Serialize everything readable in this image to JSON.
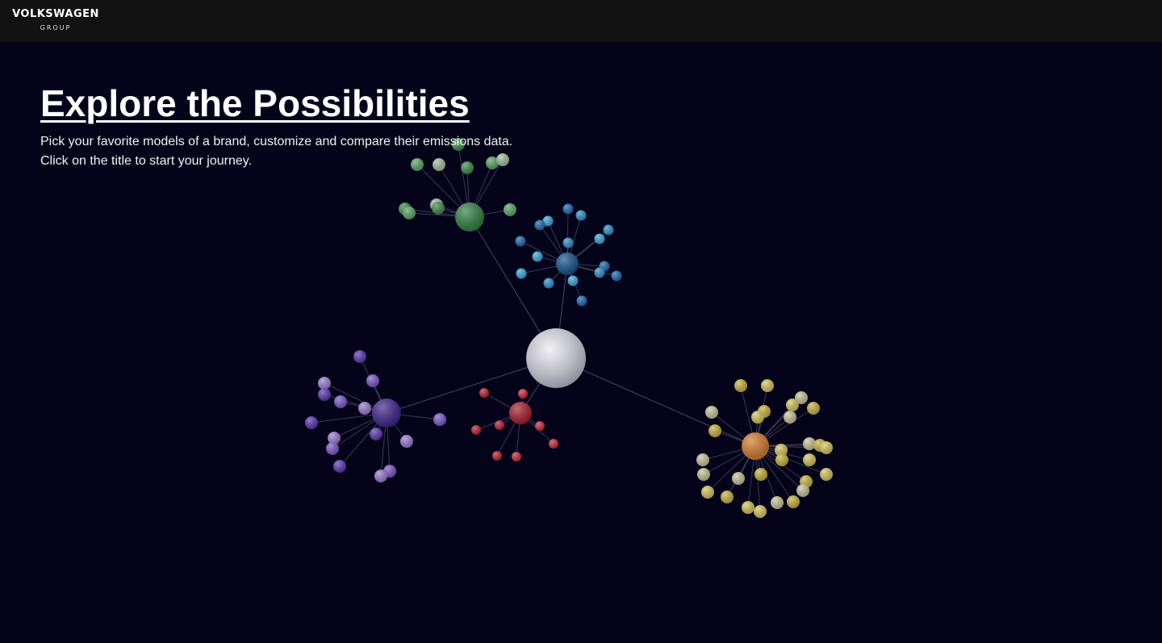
{
  "header": {
    "logo_main": "VOLKSWAGEN",
    "logo_sub": "GROUP"
  },
  "intro": {
    "title": "Explore the Possibilities",
    "line1": "Pick your favorite models of a brand, customize and compare their emissions data.",
    "line2": "Click on the title to start your journey."
  },
  "graph": {
    "background": "#04031a",
    "center_color": "#c9c9d1",
    "clusters": [
      {
        "id": "green",
        "color": "#2f7f3e",
        "leaf_colors": [
          "#3a8a46",
          "#5aa463",
          "#9fbf9f"
        ]
      },
      {
        "id": "blue",
        "color": "#0f4f8a",
        "leaf_colors": [
          "#1a67b0",
          "#2a8fc8",
          "#3aa8d8"
        ]
      },
      {
        "id": "purple",
        "color": "#3b1f8a",
        "leaf_colors": [
          "#5a34b0",
          "#7a56c8",
          "#9a7ad0"
        ]
      },
      {
        "id": "red",
        "color": "#a81a2a",
        "leaf_colors": [
          "#b82030",
          "#c82838"
        ]
      },
      {
        "id": "orange",
        "color": "#d47a2a",
        "leaf_colors": [
          "#c9b23a",
          "#d6c55a",
          "#c8c49a"
        ]
      }
    ]
  }
}
